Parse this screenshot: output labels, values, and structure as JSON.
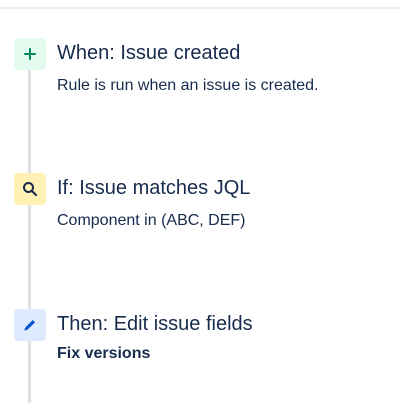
{
  "colors": {
    "trigger_bg": "#E3FCEF",
    "trigger_icon": "#00875A",
    "condition_bg": "#FFF0B3",
    "condition_icon": "#172B4D",
    "action_bg": "#DEEBFF",
    "action_icon": "#0052CC",
    "connector": "#DFE1E6",
    "text": "#172B4D"
  },
  "steps": [
    {
      "icon": "plus-icon",
      "title": "When: Issue created",
      "description": "Rule is run when an issue is created."
    },
    {
      "icon": "search-icon",
      "title": "If: Issue matches JQL",
      "description": "Component in (ABC, DEF)"
    },
    {
      "icon": "pencil-icon",
      "title": "Then: Edit issue fields",
      "description": "Fix versions"
    }
  ]
}
